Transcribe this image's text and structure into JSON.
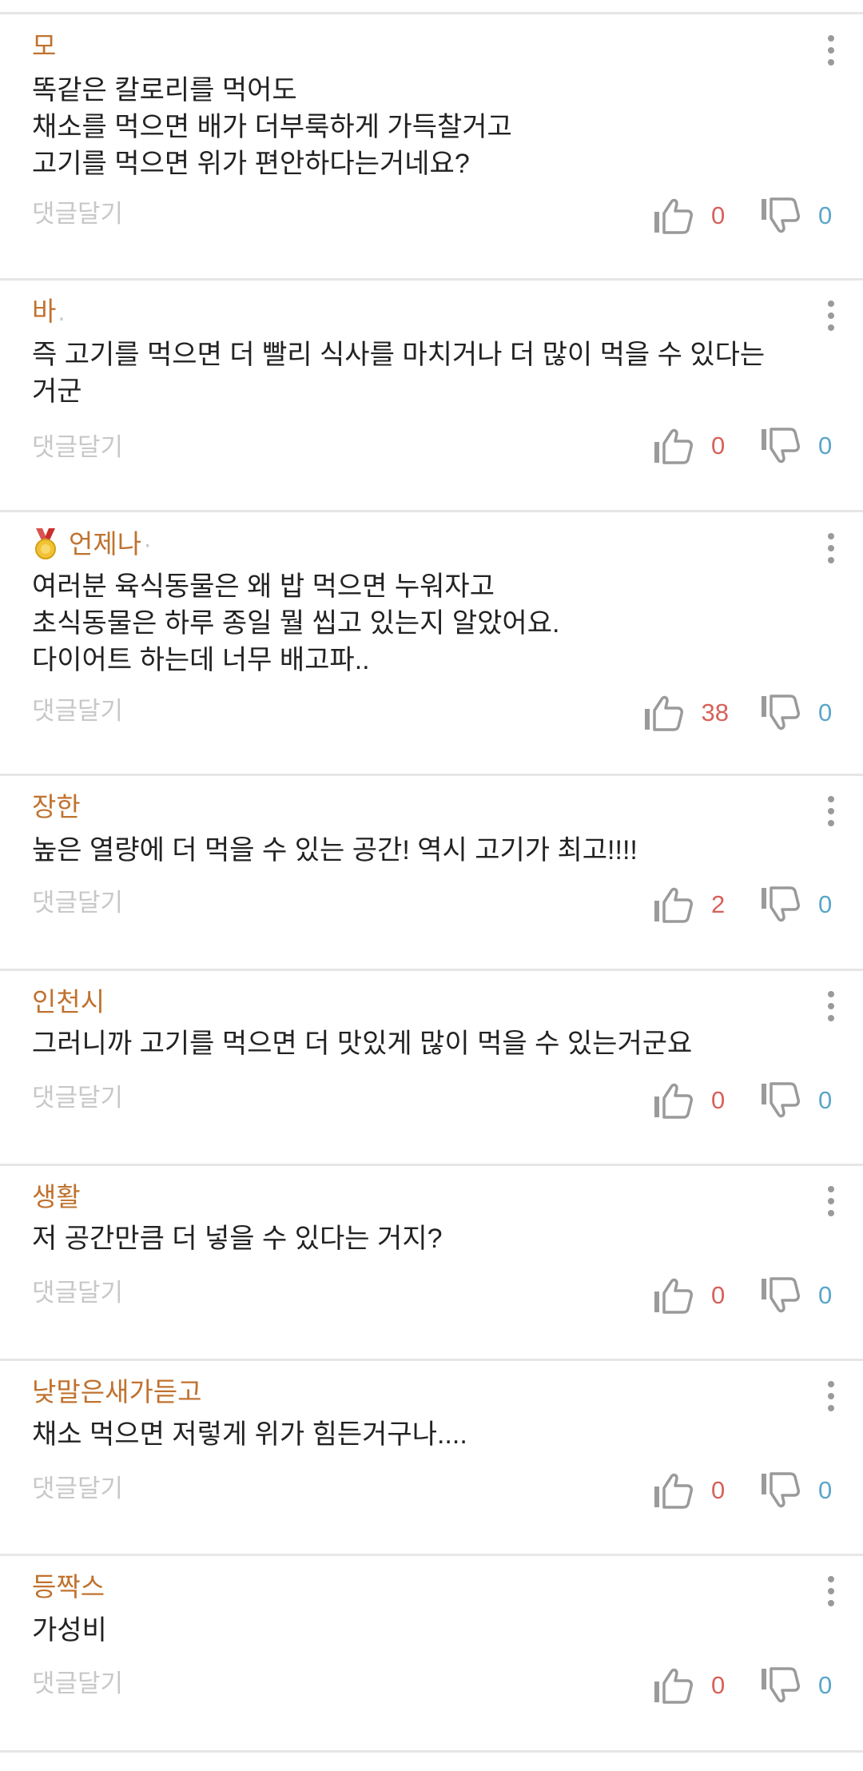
{
  "reply_label": "댓글달기",
  "comments": [
    {
      "author": "모",
      "trail": "",
      "medal": false,
      "text": "똑같은 칼로리를 먹어도\n채소를 먹으면 배가 더부룩하게 가득찰거고\n고기를 먹으면 위가 편안하다는거네요?",
      "likes": "0",
      "dislikes": "0"
    },
    {
      "author": "바",
      "trail": ".",
      "medal": false,
      "text": "즉 고기를 먹으면 더 빨리 식사를 마치거나 더 많이 먹을 수 있다는\n거군",
      "likes": "0",
      "dislikes": "0"
    },
    {
      "author": "언제나",
      "trail": "·",
      "medal": true,
      "text": "여러분 육식동물은 왜 밥 먹으면 누워자고\n초식동물은 하루 종일 뭘 씹고 있는지 알았어요.\n다이어트 하는데 너무 배고파..",
      "likes": "38",
      "dislikes": "0"
    },
    {
      "author": "장한",
      "trail": "",
      "medal": false,
      "text": "높은 열량에 더 먹을 수 있는 공간! 역시 고기가 최고!!!!",
      "likes": "2",
      "dislikes": "0"
    },
    {
      "author": "인천시",
      "trail": "",
      "medal": false,
      "text": "그러니까 고기를 먹으면 더 맛있게 많이 먹을 수 있는거군요",
      "likes": "0",
      "dislikes": "0"
    },
    {
      "author": "생활",
      "trail": "",
      "medal": false,
      "text": "저 공간만큼 더 넣을 수 있다는 거지?",
      "likes": "0",
      "dislikes": "0"
    },
    {
      "author": "낮말은새가듣고",
      "trail": "",
      "medal": false,
      "text": "채소 먹으면 저렇게 위가 힘든거구나....",
      "likes": "0",
      "dislikes": "0"
    },
    {
      "author": "등짝스",
      "trail": "",
      "medal": false,
      "text": "가성비",
      "likes": "0",
      "dislikes": "0"
    }
  ],
  "colors": {
    "author": "#c0722f",
    "like_count": "#d7615a",
    "dislike_count": "#5aa6cb",
    "reply": "#c8c8c8",
    "divider": "#e6e6e6"
  },
  "icons": {
    "like": "thumbs-up-icon",
    "dislike": "thumbs-down-icon",
    "more": "more-vertical-icon",
    "medal": "gold-medal-icon"
  }
}
